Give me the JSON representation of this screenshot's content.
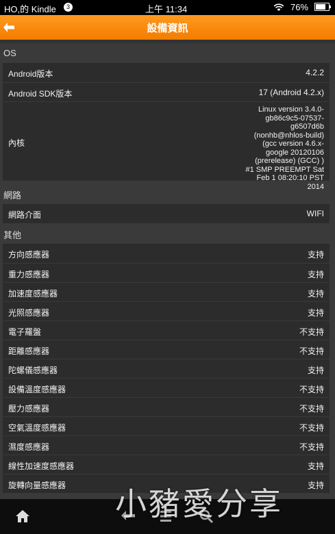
{
  "status_bar": {
    "carrier": "HO,的 Kindle",
    "notification_count": "3",
    "time": "上午 11:34",
    "battery_percent": "76%",
    "battery_level": 0.76
  },
  "title_bar": {
    "title": "設備資訊",
    "back_icon": "back-arrow-icon",
    "background_color": "#f5830a"
  },
  "sections": {
    "os": {
      "header": "OS",
      "rows": [
        {
          "label": "Android版本",
          "value": "4.2.2"
        },
        {
          "label": "Android SDK版本",
          "value": "17  (Android 4.2.x)"
        },
        {
          "label": "內核",
          "value": "Linux version 3.4.0-gb86c9c5-07537-g6507d6b (nonhb@nhlos-build) (gcc version 4.6.x-google 20120106 (prerelease) (GCC) ) #1 SMP PREEMPT Sat Feb 1 08:20:10 PST 2014"
        }
      ]
    },
    "network": {
      "header": "網路",
      "rows": [
        {
          "label": "網路介面",
          "value": "WIFI"
        }
      ]
    },
    "other": {
      "header": "其他",
      "rows": [
        {
          "label": "方向感應器",
          "value": "支持"
        },
        {
          "label": "重力感應器",
          "value": "支持"
        },
        {
          "label": "加速度感應器",
          "value": "支持"
        },
        {
          "label": "光照感應器",
          "value": "支持"
        },
        {
          "label": "電子羅盤",
          "value": "不支持"
        },
        {
          "label": "距離感應器",
          "value": "不支持"
        },
        {
          "label": "陀螺儀感應器",
          "value": "支持"
        },
        {
          "label": "設備溫度感應器",
          "value": "不支持"
        },
        {
          "label": "壓力感應器",
          "value": "不支持"
        },
        {
          "label": "空氣溫度感應器",
          "value": "不支持"
        },
        {
          "label": "濕度感應器",
          "value": "不支持"
        },
        {
          "label": "線性加速度感應器",
          "value": "支持"
        },
        {
          "label": "旋轉向量感應器",
          "value": "支持"
        }
      ]
    }
  },
  "nav_bar": {
    "icons": [
      "home-icon",
      "back-icon",
      "menu-icon",
      "search-icon"
    ]
  },
  "watermark": "小豬愛分享"
}
